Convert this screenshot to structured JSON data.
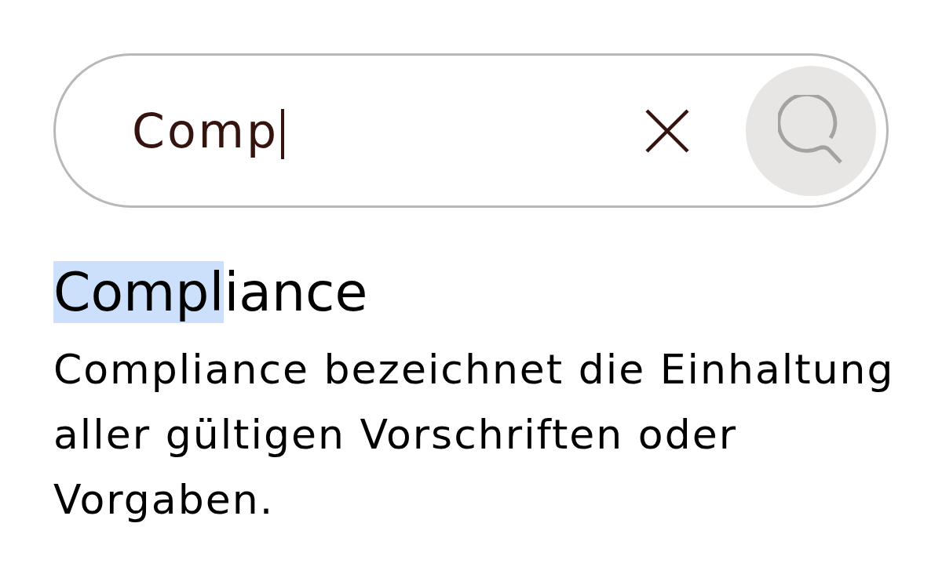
{
  "search": {
    "value": "Comp",
    "focused": true
  },
  "result": {
    "title_parts": [
      {
        "text": "Compl",
        "highlighted": true
      },
      {
        "text": "iance",
        "highlighted": false
      }
    ],
    "description": "Compliance bezeichnet die Einhaltung aller gültigen Vorschriften oder Vorgaben."
  }
}
